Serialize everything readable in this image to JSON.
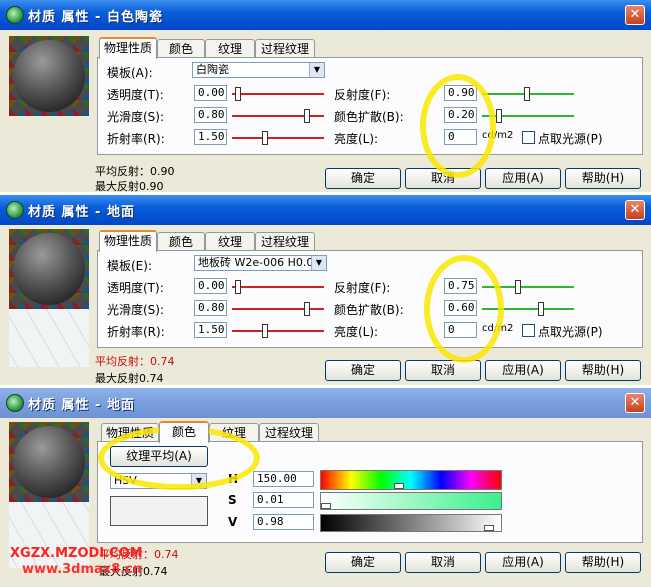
{
  "dialogs": [
    {
      "title": "材质 属性 - 白色陶瓷",
      "tabs": [
        "物理性质",
        "颜色",
        "纹理",
        "过程纹理"
      ],
      "template_label": "模板(A):",
      "template_value": "白陶瓷",
      "labels": {
        "transparency": "透明度(T):",
        "smoothness": "光滑度(S):",
        "refraction": "折射率(R):",
        "reflectance": "反射度(F):",
        "color_bleed": "颜色扩散(B):",
        "luminance": "亮度(L):"
      },
      "values": {
        "transparency": "0.00",
        "smoothness": "0.80",
        "refraction": "1.50",
        "reflectance": "0.90",
        "color_bleed": "0.20",
        "luminance": "0"
      },
      "unit": "cd/m2",
      "pick_light": "点取光源(P)",
      "avg_reflection": "平均反射：0.90",
      "max_reflection": "最大反射0.90",
      "buttons": [
        "确定",
        "取消",
        "应用(A)",
        "帮助(H)"
      ]
    },
    {
      "title": "材质 属性 - 地面",
      "tabs": [
        "物理性质",
        "颜色",
        "纹理",
        "过程纹理"
      ],
      "template_label": "模板(E):",
      "template_value": "地板砖 W2e-006 H0.0",
      "labels": {
        "transparency": "透明度(T):",
        "smoothness": "光滑度(S):",
        "refraction": "折射率(R):",
        "reflectance": "反射度(F):",
        "color_bleed": "颜色扩散(B):",
        "luminance": "亮度(L):"
      },
      "values": {
        "transparency": "0.00",
        "smoothness": "0.80",
        "refraction": "1.50",
        "reflectance": "0.75",
        "color_bleed": "0.60",
        "luminance": "0"
      },
      "unit": "cd/m2",
      "pick_light": "点取光源(P)",
      "avg_reflection": "平均反射：0.74",
      "max_reflection": "最大反射0.74",
      "buttons": [
        "确定",
        "取消",
        "应用(A)",
        "帮助(H)"
      ]
    },
    {
      "title": "材质 属性 - 地面",
      "tabs": [
        "物理性质",
        "颜色",
        "纹理",
        "过程纹理"
      ],
      "texture_average_button": "纹理平均(A)",
      "color_model": "HSV",
      "hsv_labels": {
        "h": "H",
        "s": "S",
        "v": "V"
      },
      "hsv_values": {
        "h": "150.00",
        "s": "0.01",
        "v": "0.98"
      },
      "avg_reflection": "平均反射：0.74",
      "max_reflection": "最大反射0.74",
      "buttons": [
        "确定",
        "取消",
        "应用(A)",
        "帮助(H)"
      ]
    }
  ],
  "watermark": {
    "line1": "XGZX.MZODI.COM",
    "line2": "www.3dmax8.cn"
  },
  "colors": {
    "titlebar": "#0a5fd8",
    "close": "#c4401f",
    "highlight": "#f0d800",
    "watermark_red": "#ff0000"
  }
}
